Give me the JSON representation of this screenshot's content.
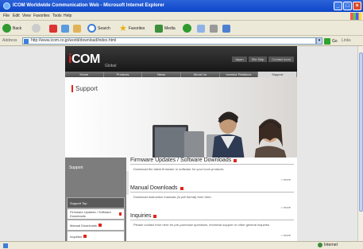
{
  "window": {
    "title": "ICOM Worldwide Communication Web - Microsoft Internet Explorer"
  },
  "menu": [
    "File",
    "Edit",
    "View",
    "Favorites",
    "Tools",
    "Help"
  ],
  "toolbar": {
    "back_label": "Back",
    "search_label": "Search",
    "favorites_label": "Favorites",
    "media_label": "Media"
  },
  "address": {
    "label": "Address",
    "url": "http://www.icom.co.jp/world/download/index.html",
    "go_label": "Go",
    "links_label": "Links"
  },
  "status": {
    "zone": "Internet"
  },
  "site": {
    "logo_prefix": "i",
    "logo_rest": "COM",
    "logo_sub": "Global",
    "header_links": [
      "Japan",
      "Site Map",
      "Contact Icom"
    ],
    "nav": [
      "Home",
      "Products",
      "News",
      "About Us",
      "Investor Relations",
      "Support"
    ],
    "page_heading": "Support",
    "sidebar_title": "Support",
    "sidebar_items": [
      "Support Top",
      "Firmware Updates / Software Downloads",
      "Manual Downloads",
      "Inquiries"
    ],
    "sections": [
      {
        "title": "Firmware Updates / Software Downloads",
        "desc": "Download the latest firmware or software for your Icom products.",
        "more": "> more"
      },
      {
        "title": "Manual Downloads",
        "desc": "Download instruction manuals (in pdf format) from here.",
        "more": "> more"
      },
      {
        "title": "Inquiries",
        "desc": "Please contact from here for pre-purchase questions, technical support or other general inquiries.",
        "more": "> more"
      }
    ]
  },
  "colors": {
    "xp_title": "#0d46c9",
    "icom_red": "#e3241b",
    "header_dark": "#111111"
  }
}
